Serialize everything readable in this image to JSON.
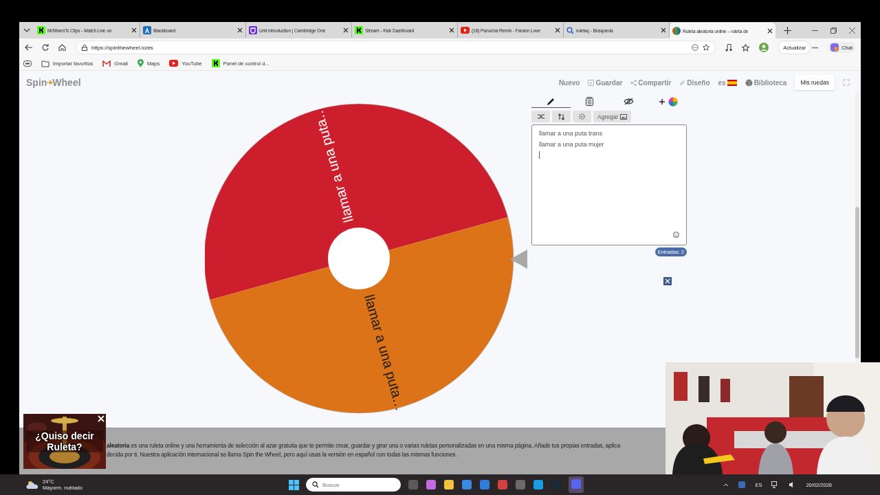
{
  "browser": {
    "tabs": [
      {
        "title": "MrStivenTc Clips - Watch Live on",
        "kind": "kick",
        "selected": false
      },
      {
        "title": "Blackboard",
        "kind": "blackboard",
        "selected": false
      },
      {
        "title": "Unit introduction | Cambridge One",
        "kind": "cambridge",
        "selected": false
      },
      {
        "title": "Stream - Kick Dashboard",
        "kind": "kick",
        "selected": false
      },
      {
        "title": "(18) Panocha Remix - Faraón Love",
        "kind": "youtube",
        "selected": false
      },
      {
        "title": "ruletaç - Búsqueda",
        "kind": "search",
        "selected": false
      },
      {
        "title": "Ruleta aleatoria online – ruleta de",
        "kind": "wheel",
        "selected": true
      }
    ],
    "url": "https://spinthewheel.io/es",
    "update_label": "Actualizar",
    "chat_label": "Chat",
    "bookmarks": [
      {
        "label": "Importar favoritos",
        "kind": "import"
      },
      {
        "label": "Gmail",
        "kind": "gmail"
      },
      {
        "label": "Maps",
        "kind": "maps"
      },
      {
        "label": "YouTube",
        "kind": "youtube"
      },
      {
        "label": "Panel de control d...",
        "kind": "kick"
      }
    ]
  },
  "site": {
    "logo": {
      "before": "Spin",
      "after": "Wheel"
    },
    "nav": [
      {
        "label": "Nuevo",
        "kind": "plain"
      },
      {
        "label": "Guardar",
        "kind": "save"
      },
      {
        "label": "Compartir",
        "kind": "share"
      },
      {
        "label": "Diseño",
        "kind": "design"
      },
      {
        "label": "es",
        "kind": "language"
      },
      {
        "label": "Biblioteca",
        "kind": "library"
      },
      {
        "label": "Mis ruedas",
        "kind": "primary"
      }
    ],
    "wheel": {
      "slices": [
        {
          "label": "llamar a una puta…",
          "color": "#cc1e2d"
        },
        {
          "label": "llamar a una puta…",
          "color": "#dd7319"
        }
      ]
    },
    "editor": {
      "tabs": [
        {
          "kind": "edit",
          "selected": true
        },
        {
          "kind": "list",
          "selected": false
        },
        {
          "kind": "hide",
          "selected": false
        },
        {
          "kind": "add-color",
          "selected": false
        }
      ],
      "add_label": "Agregar",
      "entries": [
        "llamar a una puta trans",
        "llamar a una puta mujer"
      ],
      "count": "Entradas: 2"
    },
    "description": [
      "**aleatoria** es una ruleta online y una herramienta de selección al azar gratuita que te permite crear, guardar y girar una o varias ruletas personalizadas en una misma página. Añade tus propias entradas, aplica",
      "decida por ti. Nuestra aplicación internacional se llama Spin the Wheel, pero aquí usas la versión en español con todas las mismas funciones."
    ]
  },
  "ad_overlay": {
    "caption": "¿Quiso decir Ruleta?"
  },
  "taskbar": {
    "temperature": "24°C",
    "weather": "Mayorm. nublado",
    "search_placeholder": "Buscar",
    "language": "ES",
    "date": "20/02/2026"
  }
}
